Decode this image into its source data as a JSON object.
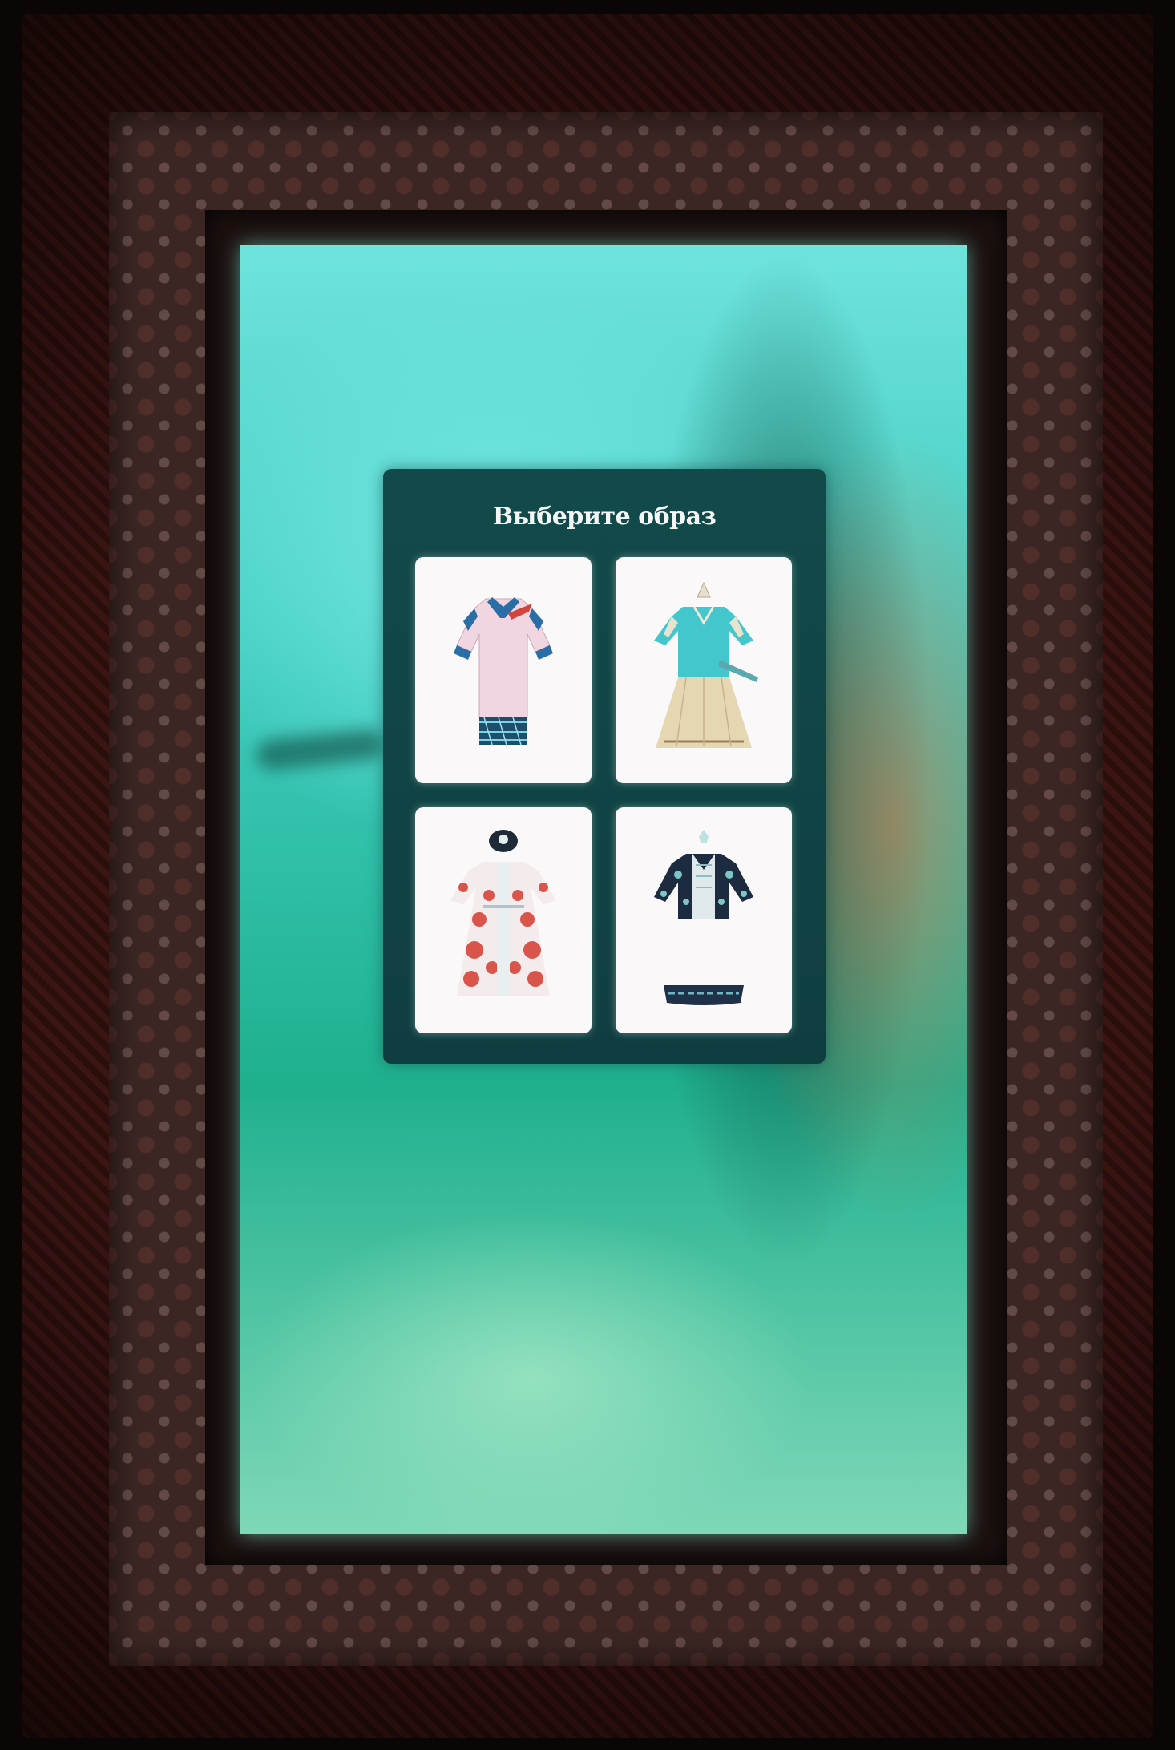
{
  "dialog": {
    "title": "Выберите образ"
  },
  "options": [
    {
      "icon": "costume-blue-trim-robe-icon"
    },
    {
      "icon": "costume-turquoise-vest-icon"
    },
    {
      "icon": "costume-red-floral-coat-icon"
    },
    {
      "icon": "costume-dark-embroidered-jacket-icon"
    }
  ],
  "colors": {
    "panel": "#124a4a",
    "screen_accent": "#3cc9bb",
    "card": "#faf8f8"
  }
}
